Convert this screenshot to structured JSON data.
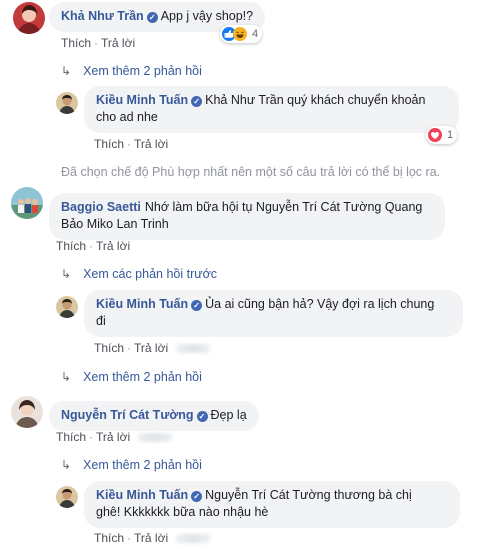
{
  "comments": [
    {
      "author": "Khả Như Trần",
      "text": "App j vậy shop!?",
      "reaction_count": "4",
      "like_label": "Thích",
      "reply_label": "Trả lời",
      "more_replies": "Xem thêm 2 phản hồi"
    },
    {
      "author": "Kiều Minh Tuấn",
      "text_line1": "Khả Như Trần quý khách chuyển khoản",
      "text_line2": "cho ad nhe",
      "reaction_count": "1",
      "like_label": "Thích",
      "reply_label": "Trả lời"
    },
    {
      "author": "Baggio Saetti",
      "text_line1": "Nhớ làm bữa hội tụ Nguyễn Trí Cát Tường Quang",
      "text_line2": "Bảo Miko Lan Trinh",
      "like_label": "Thích",
      "reply_label": "Trả lời",
      "previous_replies": "Xem các phản hồi trước"
    },
    {
      "author": "Kiều Minh Tuấn",
      "text_line1": "Ủa ai cũng bận hả? Vậy đợi ra lịch chung",
      "text_line2": "đi",
      "like_label": "Thích",
      "reply_label": "Trả lời",
      "more_replies": "Xem thêm 2 phản hồi"
    },
    {
      "author": "Nguyễn Trí Cát Tường",
      "text": "Đẹp lạ",
      "like_label": "Thích",
      "reply_label": "Trả lời",
      "more_replies": "Xem thêm 2 phản hồi"
    },
    {
      "author": "Kiều Minh Tuấn",
      "text_line1": "Nguyễn Trí Cát Tường thương bà chị",
      "text_line2": "ghê! Kkkkkkk bữa nào nhậu hè",
      "like_label": "Thích",
      "reply_label": "Trả lời"
    }
  ],
  "filter_notice": "Đã chọn chế độ Phù hợp nhất nên một số câu trả lời có thể bị lọc ra.",
  "colors": {
    "author": "#385898",
    "bubble": "#f2f3f5",
    "link": "#365899",
    "muted": "#90949c",
    "verified": "#4267b2"
  },
  "icons": [
    "verified-badge-icon",
    "like-reaction-icon",
    "haha-reaction-icon",
    "love-reaction-icon",
    "reply-arrow-icon"
  ]
}
